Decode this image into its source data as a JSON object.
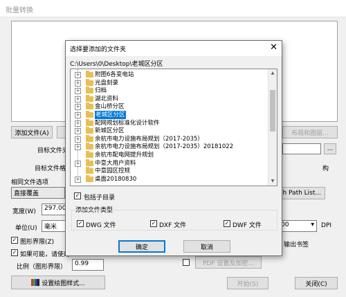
{
  "main": {
    "title": "批量转换",
    "add_file_button": "添加文件(A)",
    "layout_button": "布局和图层...",
    "target_folder_label": "目标文件夹",
    "target_format_label": "目标文件格式",
    "browse_button": "...",
    "format_suffix": "构",
    "same_file_option_label": "相同文件选项",
    "same_file_option_value": "直接覆盖",
    "search_path_button": "rch Path List...",
    "width_label": "宽度(W)",
    "width_value": "297.00",
    "unit_label": "单位(U)",
    "unit_value": "毫米",
    "dpi_value": "00",
    "dpi_label": "DPI",
    "graphics_bounds_label": "图形界限(Z)",
    "graphics_bounds_checked": true,
    "if_possible_label": "如果可能，请使用",
    "if_possible_checked": true,
    "ratio_label": "比例（图形界限）",
    "ratio_value": "0.99",
    "output_bookmark_label": "输出书签",
    "pdf_settings_button": "PDF 设置及加密...",
    "plot_style_button": "设置绘图样式...",
    "start_button": "开始(S)",
    "close_button": "关闭(C)"
  },
  "dialog": {
    "title": "选择要添加的文件夹",
    "close_glyph": "✕",
    "path": "C:\\Users\\0\\Desktop\\老城区分区",
    "tree": [
      {
        "label": "附图6各变电站",
        "expandable": true,
        "selected": false
      },
      {
        "label": "光盘刻录",
        "expandable": true,
        "selected": false
      },
      {
        "label": "归档",
        "expandable": true,
        "selected": false
      },
      {
        "label": "湖北资料",
        "expandable": true,
        "selected": false
      },
      {
        "label": "金山桥分区",
        "expandable": true,
        "selected": false
      },
      {
        "label": "老城区分区",
        "expandable": true,
        "selected": true
      },
      {
        "label": "配网规划标准化设计软件",
        "expandable": true,
        "selected": false
      },
      {
        "label": "新城区分区",
        "expandable": true,
        "selected": false
      },
      {
        "label": "余杭市电力设施布局规划（2017-2035）",
        "expandable": true,
        "selected": false
      },
      {
        "label": "余杭市电力设施布局规划（2017-2035）20181022",
        "expandable": true,
        "selected": false
      },
      {
        "label": "余杭市配电网提升规划",
        "expandable": false,
        "selected": false
      },
      {
        "label": "中意大用户资料",
        "expandable": true,
        "selected": false
      },
      {
        "label": "中意园区控规",
        "expandable": false,
        "selected": false
      },
      {
        "label": "桌面20180830",
        "expandable": true,
        "selected": false
      }
    ],
    "include_subdirs_label": "包括子目录",
    "include_subdirs_checked": true,
    "file_types_group_label": "添加文件类型",
    "types": [
      {
        "label": "DWG 文件",
        "checked": true
      },
      {
        "label": "DXF 文件",
        "checked": true
      },
      {
        "label": "DWF 文件",
        "checked": true
      }
    ],
    "ok_button": "确定",
    "cancel_button": "取消"
  },
  "icons": {
    "folder": "folder-icon",
    "plot_style": "plot-style-icon",
    "check": "✓"
  },
  "colors": {
    "selection": "#0078d7",
    "folder": "#e8bf53"
  }
}
